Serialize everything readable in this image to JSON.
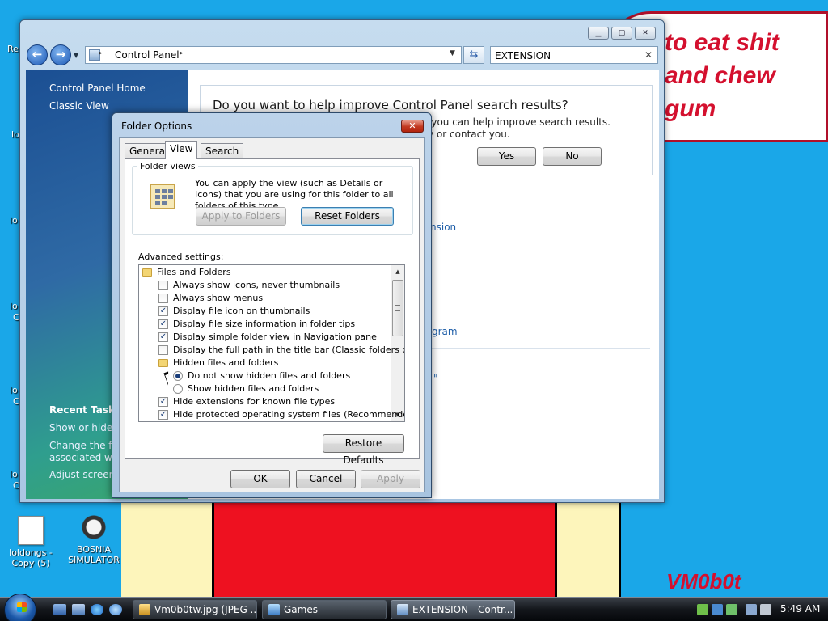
{
  "desktop": {
    "speech_bubble_lines": [
      "to eat shit",
      "and chew",
      "gum"
    ],
    "signature": "VM0b0t",
    "edge_labels": [
      "Re",
      "lo",
      "lo",
      "lo",
      "C",
      "lo",
      "C",
      "lo",
      "C"
    ],
    "icons": [
      {
        "label": "loldongs - Copy (5)",
        "icon": "document-icon"
      },
      {
        "label": "BOSNIA SIMULATOR",
        "icon": "mine-shortcut-icon"
      }
    ]
  },
  "control_panel": {
    "address_segment": "Control Panel",
    "search_value": "EXTENSION",
    "sidebar": {
      "links": [
        "Control Panel Home",
        "Classic View"
      ],
      "recent_tasks_heading": "Recent Tasks",
      "recent_tasks": [
        "Show or hide fi",
        "Change the file",
        "associated with",
        "Adjust screen r"
      ]
    },
    "improve": {
      "title": "Do you want to help improve Control Panel search results?",
      "line1": "ft, you can help improve search results.",
      "line2": "tify or contact you.",
      "yes_label": "Yes",
      "no_label": "No"
    },
    "fragments": [
      "nsion",
      "gram",
      "\""
    ]
  },
  "folder_options": {
    "title": "Folder Options",
    "close_glyph": "✕",
    "tabs": [
      "General",
      "View",
      "Search"
    ],
    "active_tab": "View",
    "folder_views": {
      "label": "Folder views",
      "description": "You can apply the view (such as Details or Icons) that you are using for this folder to all folders of this type.",
      "apply_label": "Apply to Folders",
      "reset_label": "Reset Folders"
    },
    "advanced_label": "Advanced settings:",
    "advanced_items": [
      {
        "type": "folder",
        "text": "Files and Folders",
        "level": 0
      },
      {
        "type": "checkbox",
        "text": "Always show icons, never thumbnails",
        "checked": false,
        "level": 1
      },
      {
        "type": "checkbox",
        "text": "Always show menus",
        "checked": false,
        "level": 1
      },
      {
        "type": "checkbox",
        "text": "Display file icon on thumbnails",
        "checked": true,
        "level": 1
      },
      {
        "type": "checkbox",
        "text": "Display file size information in folder tips",
        "checked": true,
        "level": 1
      },
      {
        "type": "checkbox",
        "text": "Display simple folder view in Navigation pane",
        "checked": true,
        "level": 1
      },
      {
        "type": "checkbox",
        "text": "Display the full path in the title bar (Classic folders only)",
        "checked": false,
        "level": 1
      },
      {
        "type": "folder",
        "text": "Hidden files and folders",
        "level": 1
      },
      {
        "type": "radio",
        "text": "Do not show hidden files and folders",
        "checked": true,
        "level": 2
      },
      {
        "type": "radio",
        "text": "Show hidden files and folders",
        "checked": false,
        "level": 2
      },
      {
        "type": "checkbox",
        "text": "Hide extensions for known file types",
        "checked": true,
        "level": 1
      },
      {
        "type": "checkbox",
        "text": "Hide protected operating system files (Recommended)",
        "checked": true,
        "level": 1
      }
    ],
    "restore_label": "Restore Defaults",
    "ok_label": "OK",
    "cancel_label": "Cancel",
    "apply_label": "Apply"
  },
  "taskbar": {
    "items": [
      {
        "label": "Vm0b0tw.jpg (JPEG ...",
        "icon": "image-viewer-icon",
        "active": false
      },
      {
        "label": "Games",
        "icon": "games-icon",
        "active": false
      },
      {
        "label": "EXTENSION - Contr...",
        "icon": "control-panel-icon",
        "active": true
      }
    ],
    "clock": "5:49 AM"
  },
  "colors": {
    "desktop_bg": "#1aa7e8",
    "drawing_red": "#d4102e",
    "link_blue": "#1e5ea8"
  }
}
